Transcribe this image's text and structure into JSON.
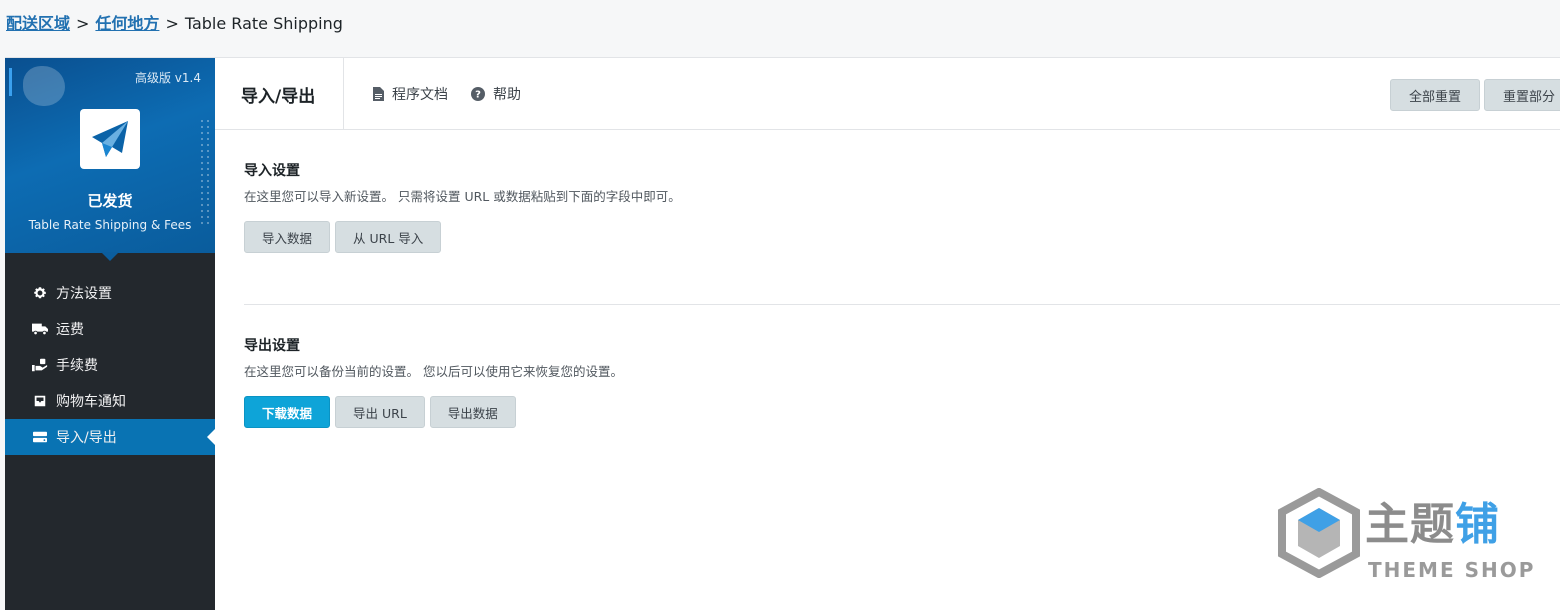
{
  "breadcrumb": {
    "items": [
      "配送区域",
      "任何地方"
    ],
    "separator": ">",
    "current": "Table Rate Shipping"
  },
  "sidebar": {
    "version": "高级版 v1.4",
    "name": "已发货",
    "subtitle": "Table Rate Shipping & Fees",
    "items": [
      {
        "label": "方法设置",
        "icon": "gear-icon"
      },
      {
        "label": "运费",
        "icon": "truck-icon"
      },
      {
        "label": "手续费",
        "icon": "hand-money-icon"
      },
      {
        "label": "购物车通知",
        "icon": "inbox-icon"
      },
      {
        "label": "导入/导出",
        "icon": "drive-icon",
        "active": true
      }
    ]
  },
  "header": {
    "title": "导入/导出",
    "docs_label": "程序文档",
    "help_label": "帮助",
    "reset_all_label": "全部重置",
    "reset_section_label": "重置部分"
  },
  "import": {
    "title": "导入设置",
    "description": "在这里您可以导入新设置。 只需将设置 URL 或数据粘贴到下面的字段中即可。",
    "import_data_label": "导入数据",
    "import_url_label": "从 URL 导入"
  },
  "export": {
    "title": "导出设置",
    "description": "在这里您可以备份当前的设置。 您以后可以使用它来恢复您的设置。",
    "download_label": "下载数据",
    "export_url_label": "导出 URL",
    "export_data_label": "导出数据"
  },
  "watermark": {
    "cn_gray": "主题",
    "cn_blue": "铺",
    "en": "THEME SHOP"
  },
  "colors": {
    "brand_blue": "#0973b3",
    "sidebar_dark": "#23282d",
    "primary_button": "#0ea4d8",
    "link": "#2271b1"
  }
}
